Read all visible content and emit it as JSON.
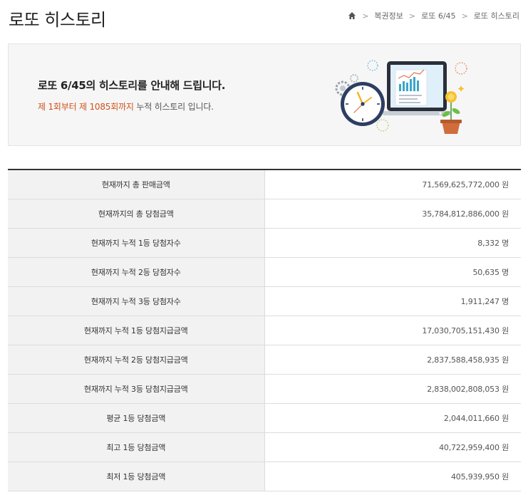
{
  "page": {
    "title": "로또 히스토리"
  },
  "breadcrumb": {
    "home_icon": "home-icon",
    "items": [
      "복권정보",
      "로또 6/45",
      "로또 히스토리"
    ]
  },
  "intro": {
    "heading": "로또 6/45의 히스토리를 안내해 드립니다.",
    "sub_highlight": "제 1회부터 제 1085회까지",
    "sub_rest": " 누적 히스토리 입니다.",
    "illustration_icon": "laptop-clock-chart-illustration"
  },
  "stats": [
    {
      "label": "현재까지 총 판매금액",
      "value": "71,569,625,772,000 원"
    },
    {
      "label": "현재까지의 총 당첨금액",
      "value": "35,784,812,886,000 원"
    },
    {
      "label": "현재까지 누적 1등 당첨자수",
      "value": "8,332 명"
    },
    {
      "label": "현재까지 누적 2등 당첨자수",
      "value": "50,635 명"
    },
    {
      "label": "현재까지 누적 3등 당첨자수",
      "value": "1,911,247 명"
    },
    {
      "label": "현재까지 누적 1등 당첨지급금액",
      "value": "17,030,705,151,430 원"
    },
    {
      "label": "현재까지 누적 2등 당첨지급금액",
      "value": "2,837,588,458,935 원"
    },
    {
      "label": "현재까지 누적 3등 당첨지급금액",
      "value": "2,838,002,808,053 원"
    },
    {
      "label": "평균 1등 당첨금액",
      "value": "2,044,011,660 원"
    },
    {
      "label": "최고 1등 당첨금액",
      "value": "40,722,959,400 원"
    },
    {
      "label": "최저 1등 당첨금액",
      "value": "405,939,950 원"
    }
  ],
  "colors": {
    "highlight": "#d1501b",
    "label_bg": "#f2f2f2",
    "intro_bg": "#f6f6f6",
    "clock_rim": "#2d3e63",
    "chart_bars": "#3aa6c9"
  }
}
